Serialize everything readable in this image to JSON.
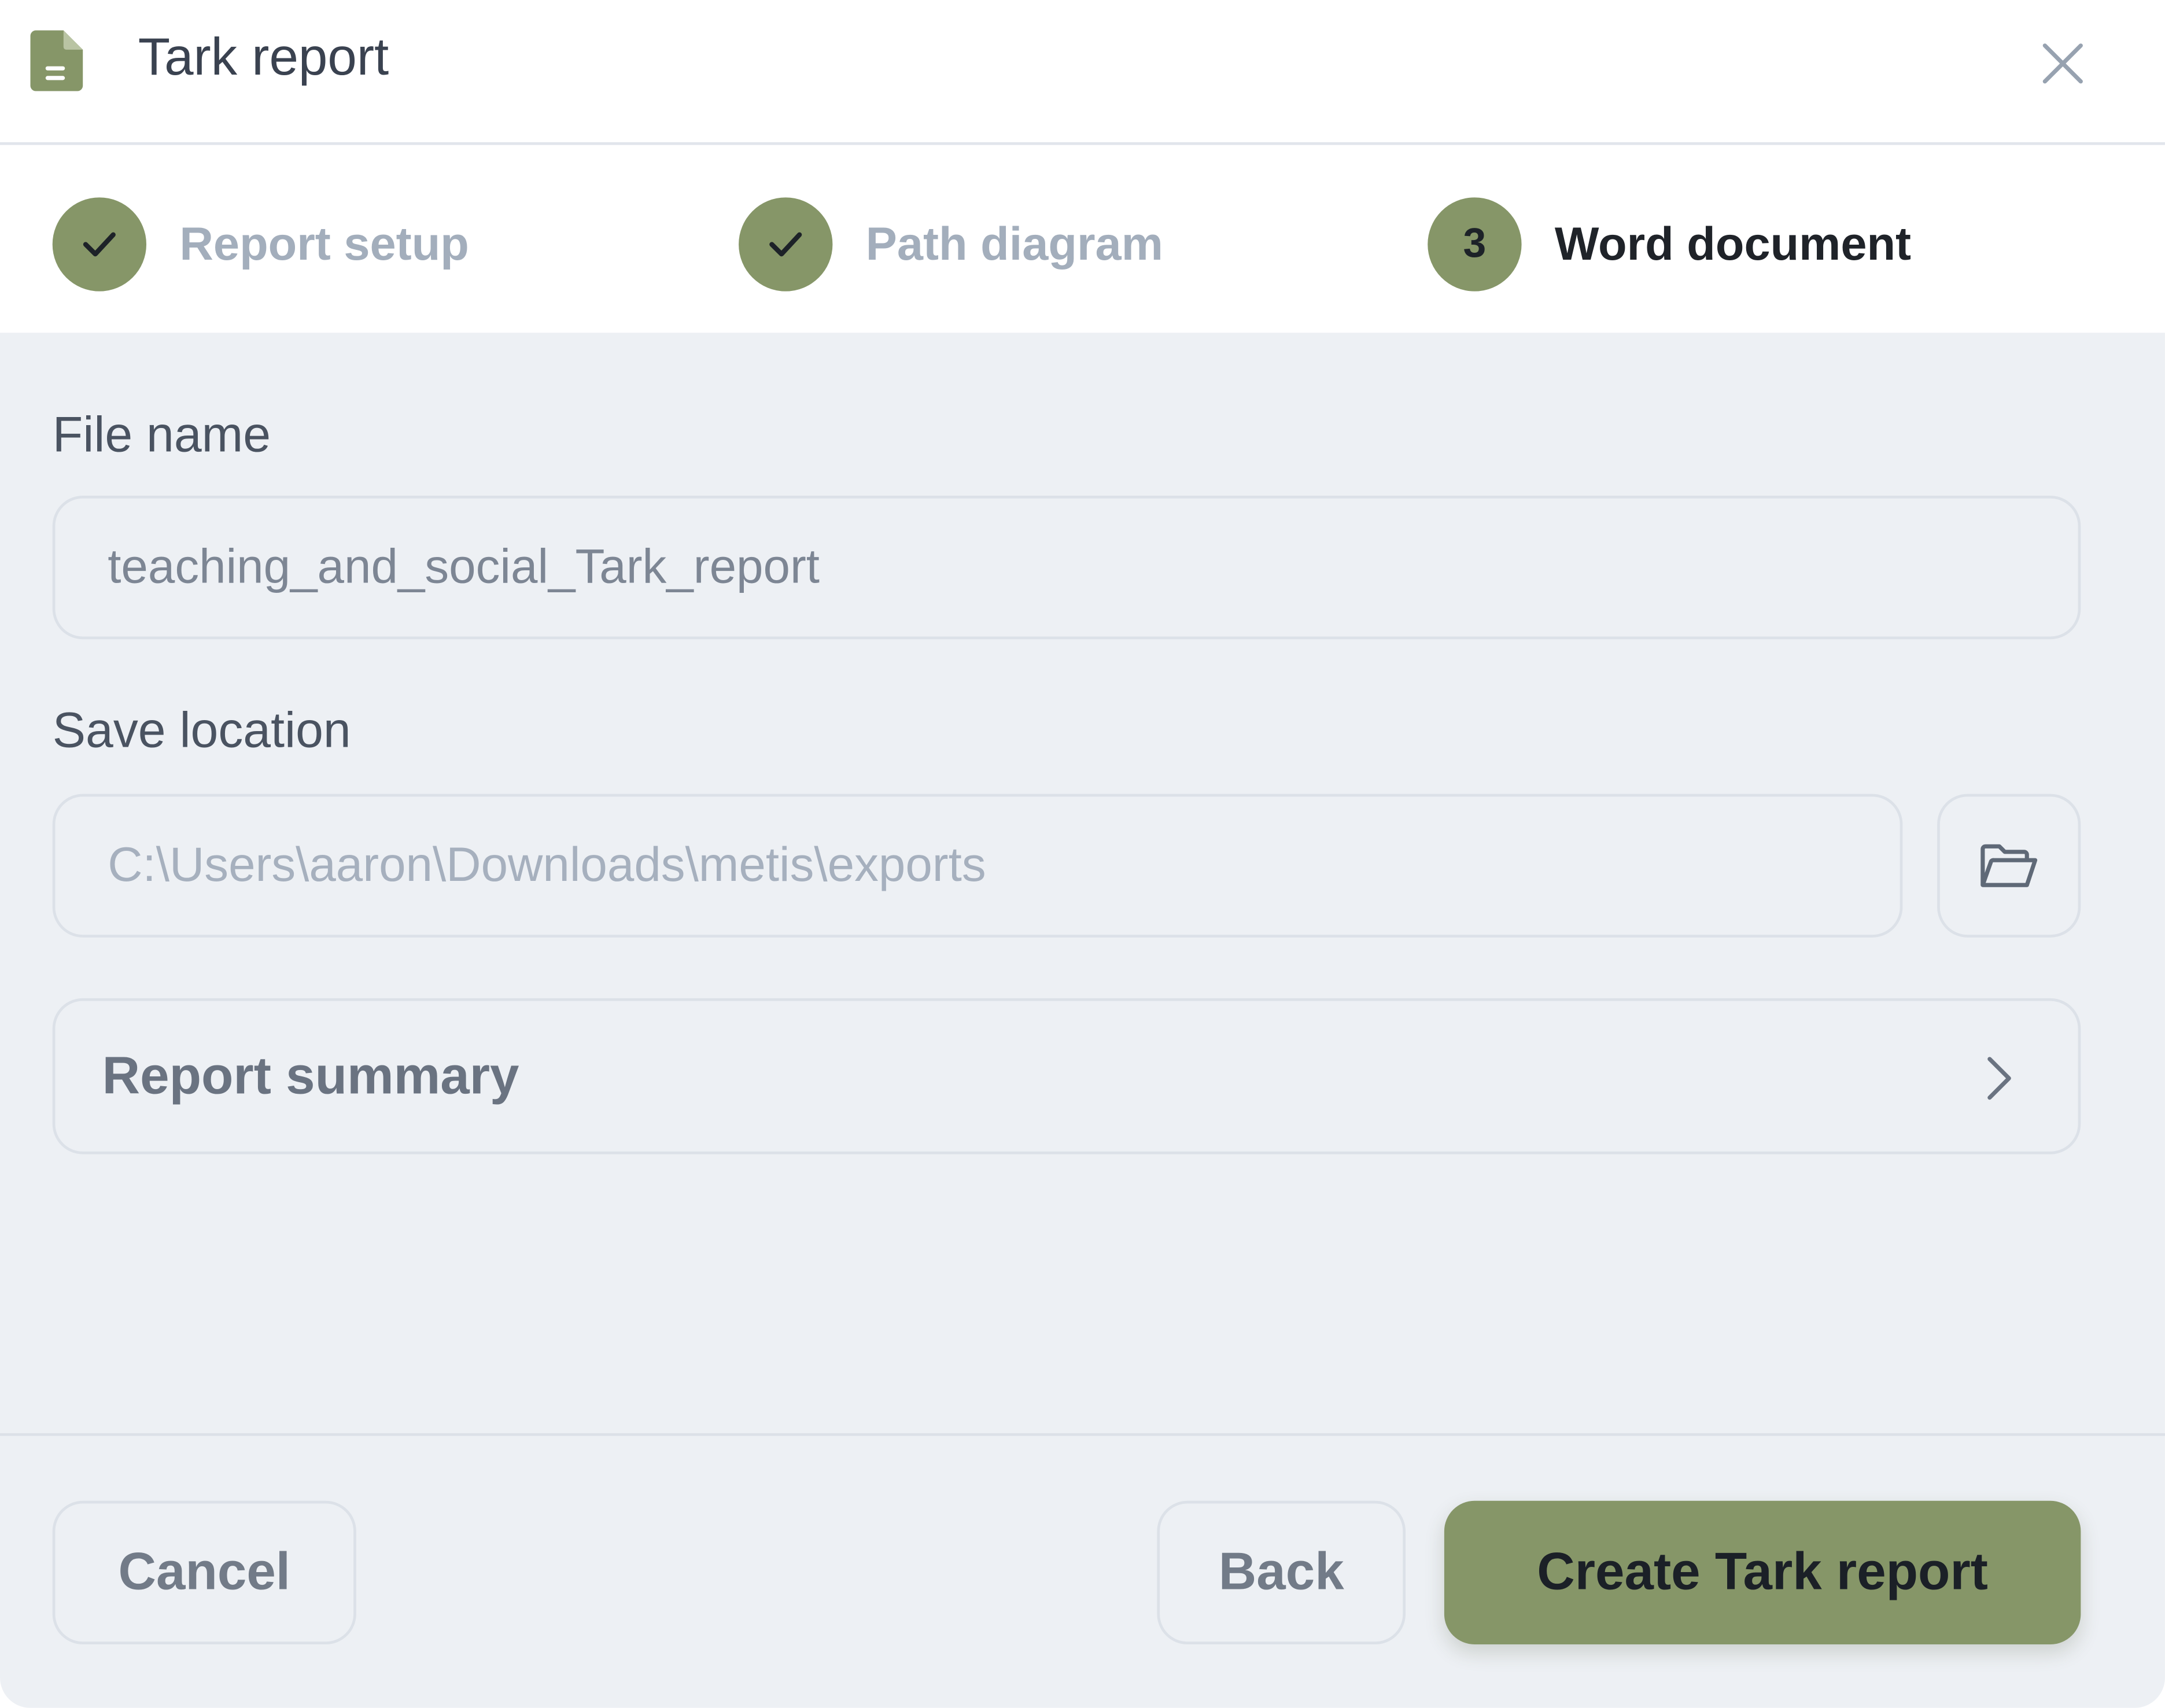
{
  "dialog": {
    "title": "Tark report"
  },
  "stepper": {
    "steps": [
      {
        "label": "Report setup",
        "state": "completed"
      },
      {
        "label": "Path diagram",
        "state": "completed"
      },
      {
        "number": "3",
        "label": "Word document",
        "state": "active"
      }
    ]
  },
  "form": {
    "file_name": {
      "label": "File name",
      "value": "teaching_and_social_Tark_report"
    },
    "save_location": {
      "label": "Save location",
      "value": "C:\\Users\\aaron\\Downloads\\metis\\exports"
    },
    "summary": {
      "label": "Report summary"
    }
  },
  "footer": {
    "cancel_label": "Cancel",
    "back_label": "Back",
    "create_label": "Create Tark report"
  },
  "colors": {
    "accent": "#869668",
    "header_bg": "#ffffff",
    "body_bg": "#edf0f4",
    "border": "#dce1e8",
    "muted_text": "#a3aebc"
  },
  "icons": {
    "header": "document-icon",
    "close": "close-icon",
    "step_done": "check-icon",
    "folder": "folder-open-icon",
    "summary": "chevron-right-icon"
  }
}
